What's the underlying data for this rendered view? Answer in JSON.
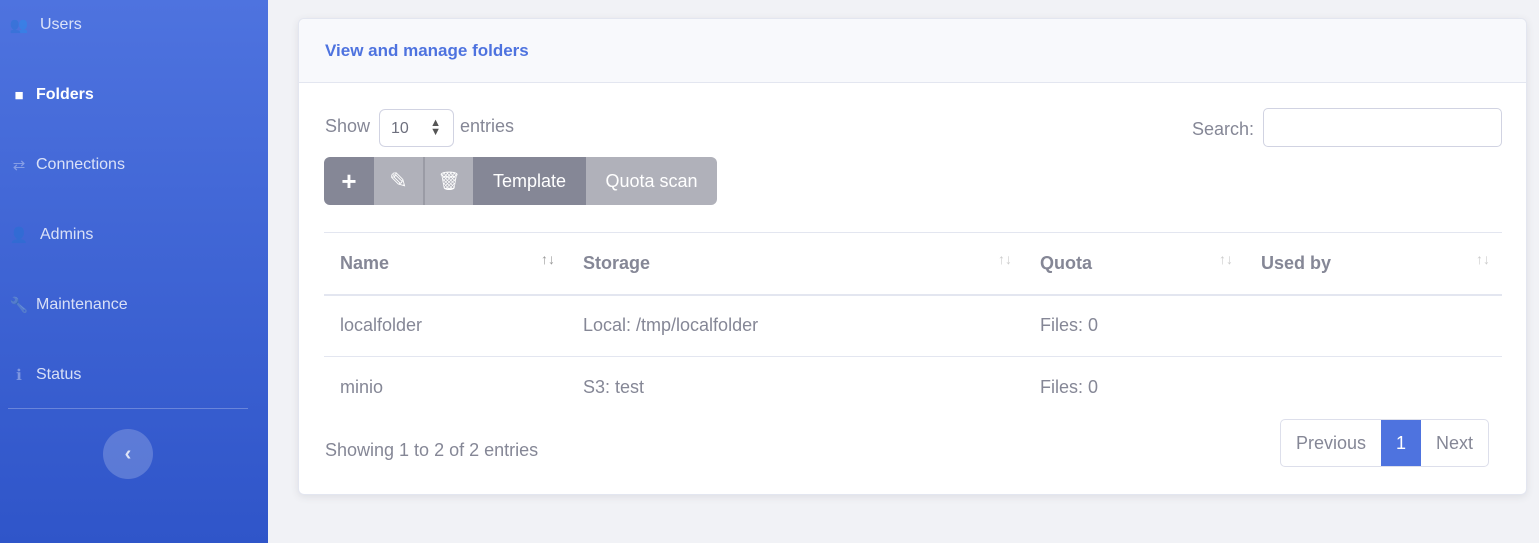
{
  "sidebar": {
    "items": [
      {
        "label": "Users",
        "icon": "users-icon",
        "glyph": "👥"
      },
      {
        "label": "Folders",
        "icon": "folder-icon",
        "glyph": "■",
        "active": true
      },
      {
        "label": "Connections",
        "icon": "exchange-icon",
        "glyph": "⇄"
      },
      {
        "label": "Admins",
        "icon": "user-cog-icon",
        "glyph": "👤"
      },
      {
        "label": "Maintenance",
        "icon": "wrench-icon",
        "glyph": "🔧"
      },
      {
        "label": "Status",
        "icon": "info-circle-icon",
        "glyph": "ℹ"
      }
    ],
    "toggle_glyph": "‹"
  },
  "card": {
    "title": "View and manage folders"
  },
  "controls": {
    "show": "Show",
    "entries_value": "10",
    "entries": "entries",
    "search_label": "Search:",
    "search_value": ""
  },
  "toolbar": {
    "add": "+",
    "edit": "✎",
    "delete": "🗑",
    "template": "Template",
    "quota_scan": "Quota scan"
  },
  "table": {
    "columns": [
      "Name",
      "Storage",
      "Quota",
      "Used by"
    ],
    "sort_glyph": "↑↓",
    "rows": [
      [
        "localfolder",
        "Local: /tmp/localfolder",
        "Files: 0",
        ""
      ],
      [
        "minio",
        "S3: test",
        "Files: 0",
        ""
      ]
    ]
  },
  "footer": {
    "info": "Showing 1 to 2 of 2 entries",
    "previous": "Previous",
    "page": "1",
    "next": "Next"
  }
}
